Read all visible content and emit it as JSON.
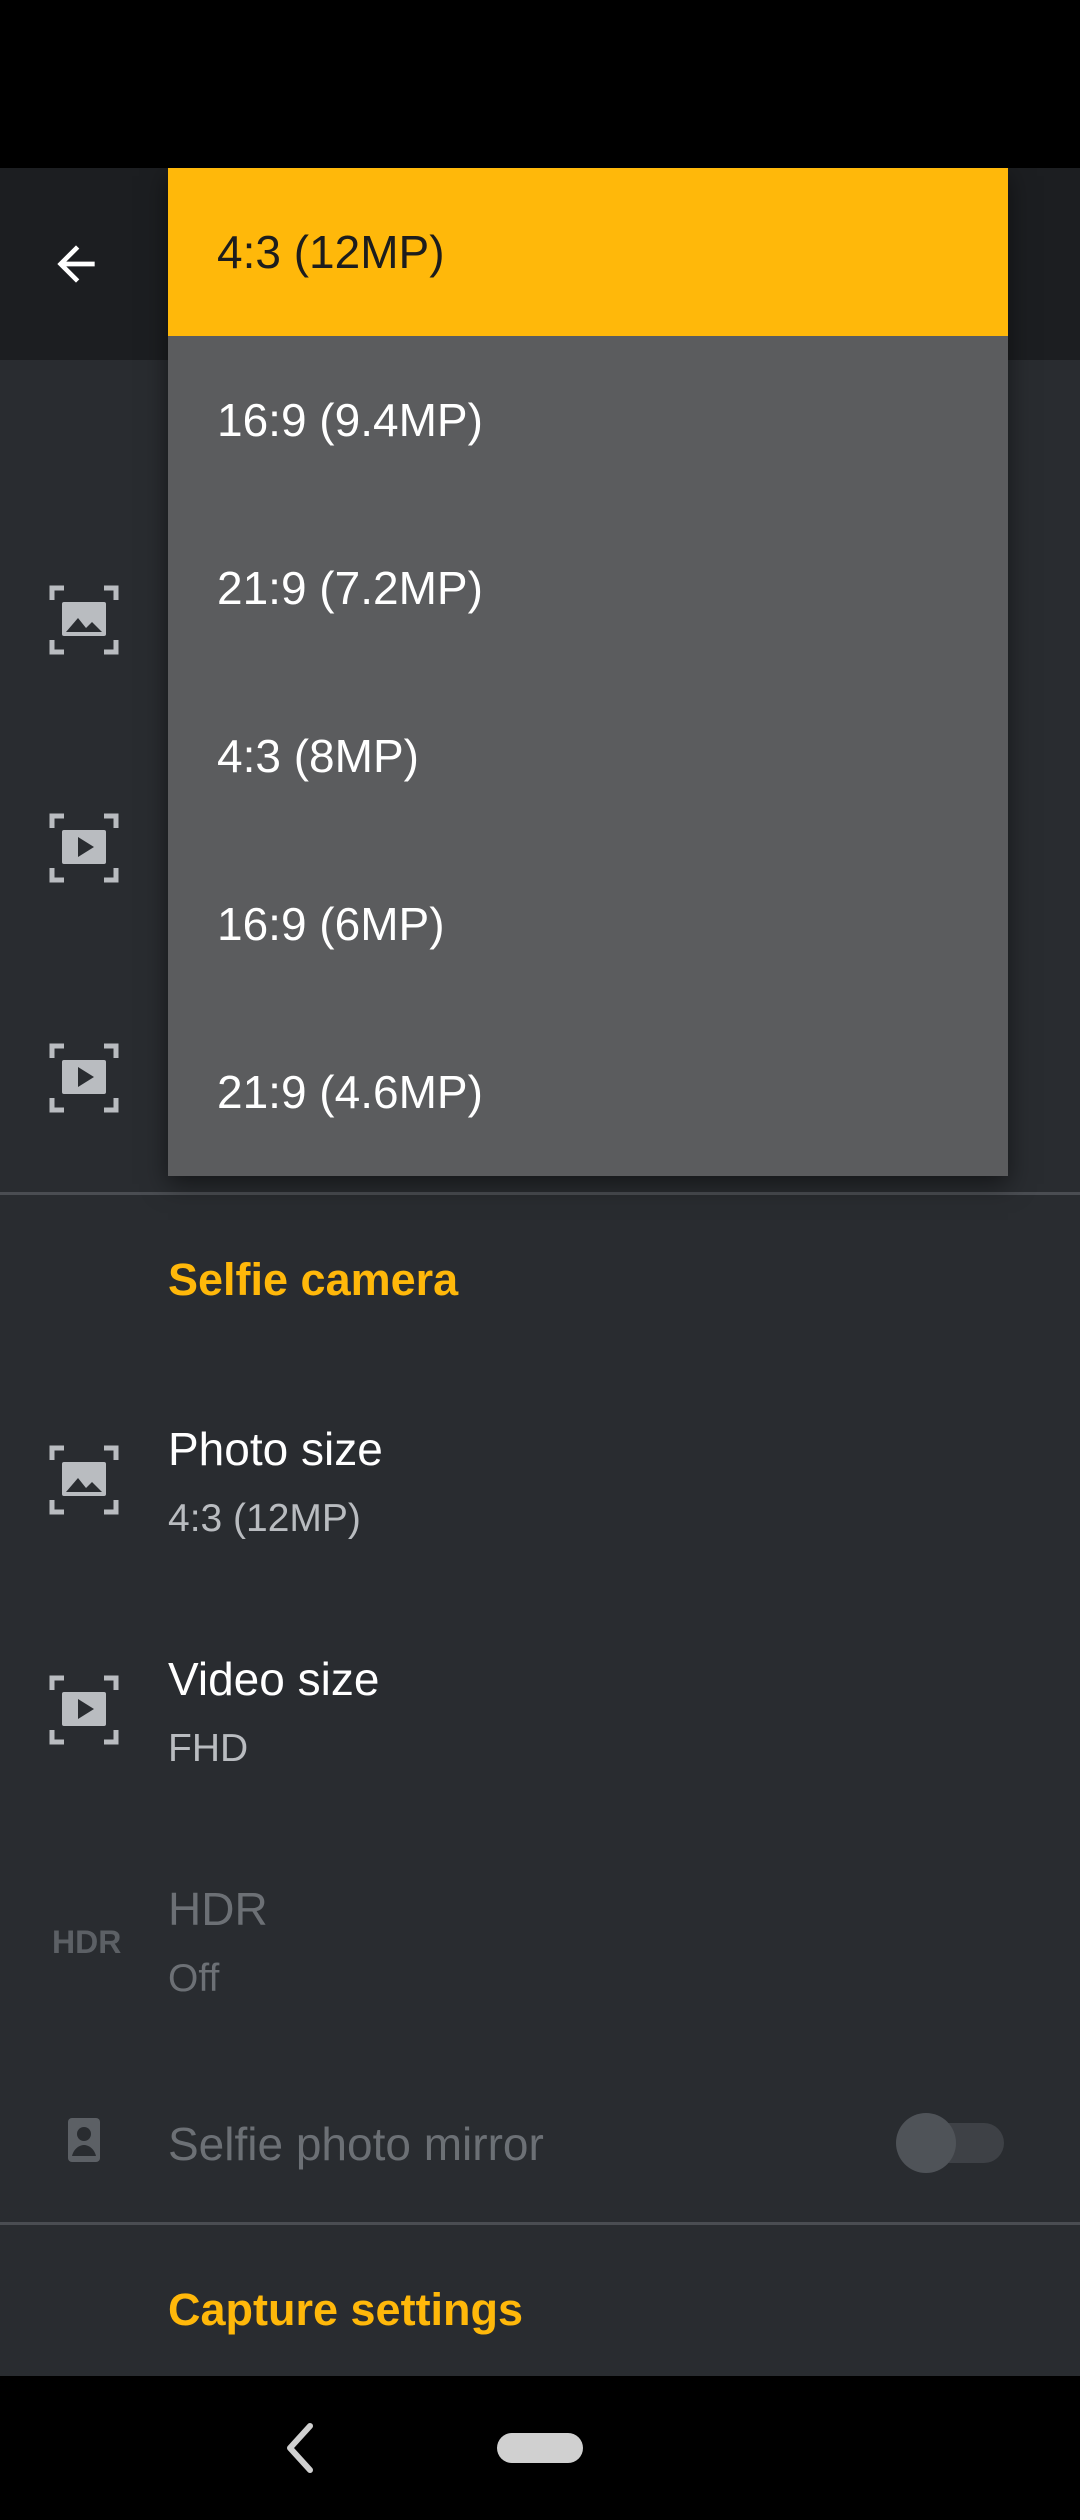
{
  "colors": {
    "accent": "#ffb80a",
    "background": "#292c30",
    "dropdown_bg": "#5b5c5e"
  },
  "app_bar": {
    "back_icon": "back-arrow-icon"
  },
  "dropdown": {
    "options": [
      {
        "label": "4:3 (12MP)",
        "selected": true
      },
      {
        "label": "16:9 (9.4MP)",
        "selected": false
      },
      {
        "label": "21:9 (7.2MP)",
        "selected": false
      },
      {
        "label": "4:3 (8MP)",
        "selected": false
      },
      {
        "label": "16:9 (6MP)",
        "selected": false
      },
      {
        "label": "21:9 (4.6MP)",
        "selected": false
      }
    ]
  },
  "selfie_section": {
    "header": "Selfie camera",
    "photo_size": {
      "title": "Photo size",
      "value": "4:3 (12MP)",
      "icon": "photo-size-icon"
    },
    "video_size": {
      "title": "Video size",
      "value": "FHD",
      "icon": "video-size-icon"
    },
    "hdr": {
      "icon_text": "HDR",
      "title": "HDR",
      "value": "Off",
      "enabled": false
    },
    "selfie_mirror": {
      "title": "Selfie photo mirror",
      "icon": "portrait-icon",
      "enabled": false,
      "checked": false
    }
  },
  "capture_section": {
    "header": "Capture settings"
  },
  "nav_bar": {
    "back_icon": "nav-back-icon",
    "home_icon": "nav-home-pill"
  }
}
